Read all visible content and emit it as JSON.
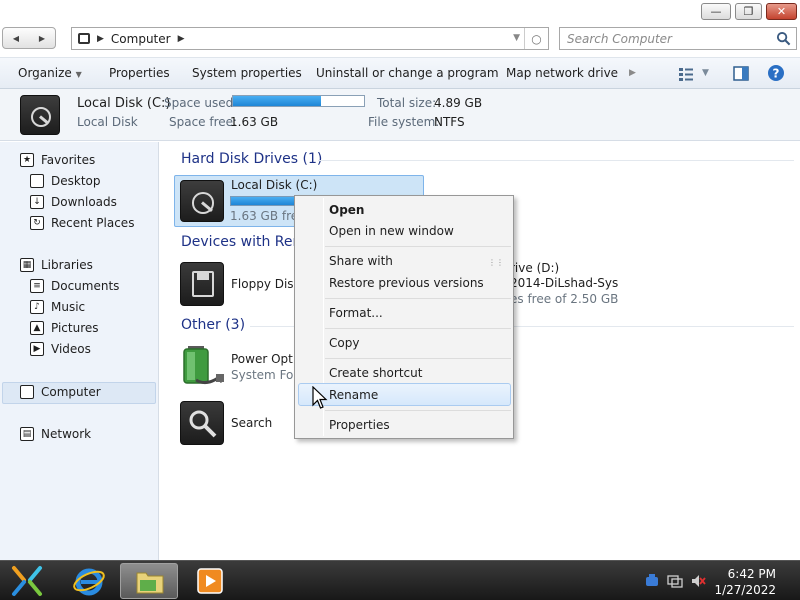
{
  "address": {
    "crumb": "Computer",
    "search_placeholder": "Search Computer"
  },
  "toolbar": {
    "organize": "Organize",
    "properties": "Properties",
    "system_properties": "System properties",
    "uninstall": "Uninstall or change a program",
    "map_drive": "Map network drive"
  },
  "details": {
    "name": "Local Disk (C:)",
    "type": "Local Disk",
    "space_used_label": "Space used:",
    "space_used_fraction": 0.67,
    "space_free_label": "Space free:",
    "space_free": "1.63 GB",
    "total_size_label": "Total size:",
    "total_size": "4.89 GB",
    "file_system_label": "File system:",
    "file_system": "NTFS"
  },
  "sidebar": {
    "favorites": "Favorites",
    "desktop": "Desktop",
    "downloads": "Downloads",
    "recent_places": "Recent Places",
    "libraries": "Libraries",
    "documents": "Documents",
    "music": "Music",
    "pictures": "Pictures",
    "videos": "Videos",
    "computer": "Computer",
    "network": "Network"
  },
  "groups": {
    "hdd_header": "Hard Disk Drives (1)",
    "removable_header": "Devices with Rem",
    "other_header": "Other (3)"
  },
  "items": {
    "local_disk_name": "Local Disk (C:)",
    "local_disk_free": "1.63 GB free",
    "local_disk_used_fraction": 0.67,
    "floppy_name": "Floppy Disk",
    "dvd_name": "rive (D:)",
    "dvd_label": "2014-DiLshad-Sys",
    "dvd_free": "es free of 2.50 GB",
    "power_name": "Power Optic",
    "power_sub": "System Fold",
    "search_name": "Search"
  },
  "context_menu": {
    "open": "Open",
    "open_new_window": "Open in new window",
    "share_with": "Share with",
    "restore": "Restore previous versions",
    "format": "Format...",
    "copy": "Copy",
    "create_shortcut": "Create shortcut",
    "rename": "Rename",
    "properties": "Properties"
  },
  "taskbar": {
    "time": "6:42 PM",
    "date": "1/27/2022"
  },
  "colors": {
    "accent_blue": "#1f86d6",
    "group_header": "#1e3287",
    "selection": "#cde4f7"
  }
}
